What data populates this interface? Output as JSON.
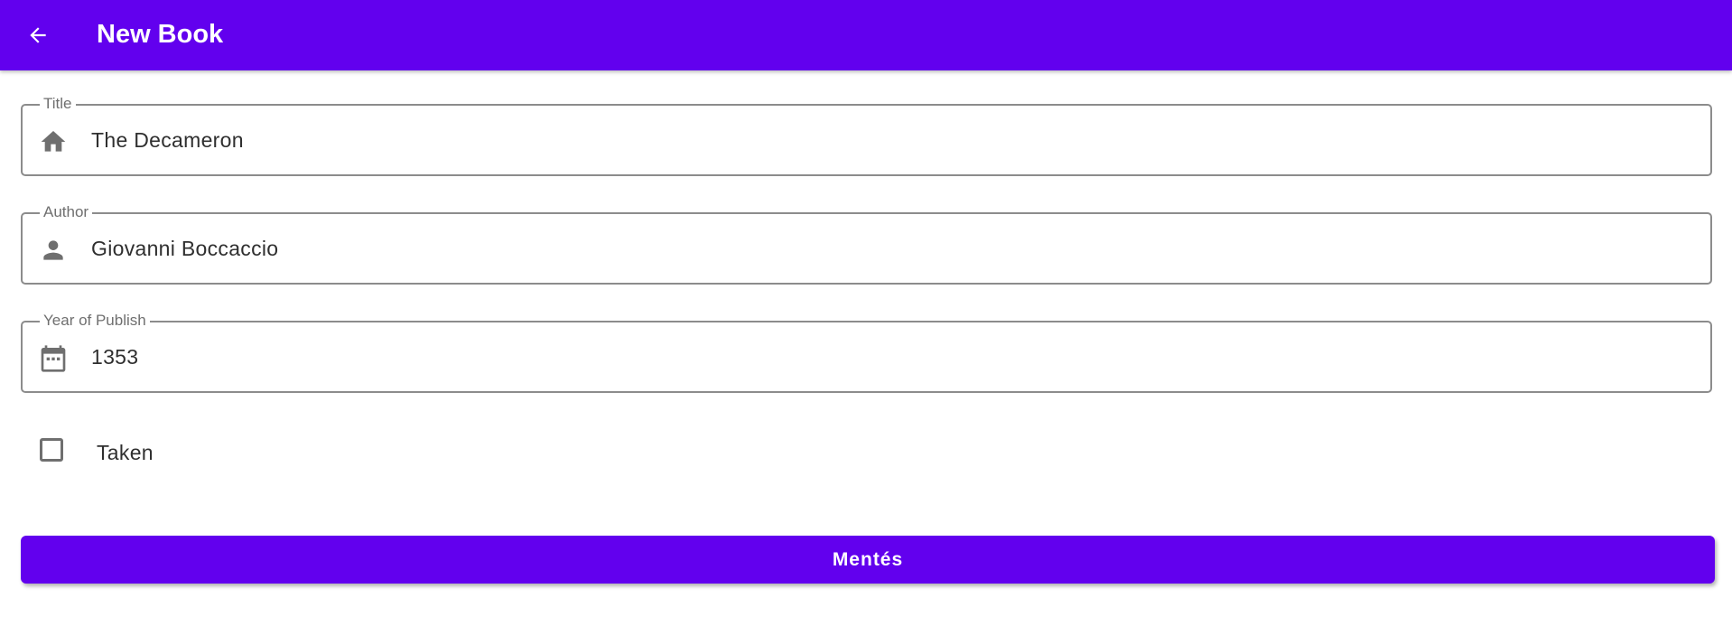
{
  "appbar": {
    "title": "New Book",
    "back_icon": "arrow-back-icon",
    "background_color": "#6200ee"
  },
  "form": {
    "title_field": {
      "label": "Title",
      "value": "The Decameron",
      "icon": "home-icon"
    },
    "author_field": {
      "label": "Author",
      "value": "Giovanni Boccaccio",
      "icon": "person-icon"
    },
    "year_field": {
      "label": "Year of Publish",
      "value": "1353",
      "icon": "calendar-icon"
    },
    "taken_checkbox": {
      "label": "Taken",
      "checked": false
    },
    "save_button": {
      "label": "Mentés",
      "color": "#6200ee"
    }
  }
}
